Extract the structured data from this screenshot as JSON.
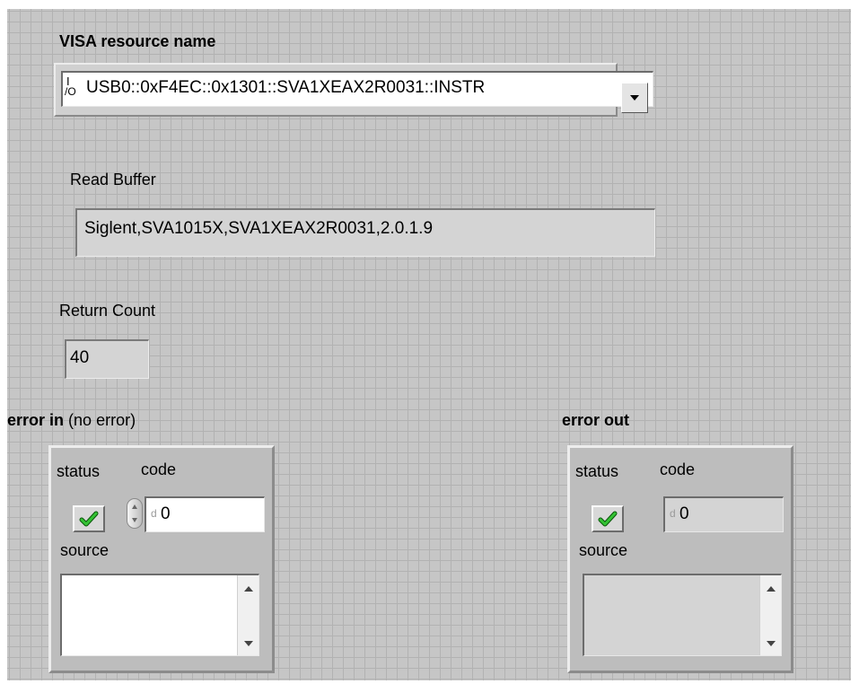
{
  "visa": {
    "label": "VISA resource name",
    "io_glyph_top": "I",
    "io_glyph_bottom": "/O",
    "value": "USB0::0xF4EC::0x1301::SVA1XEAX2R0031::INSTR",
    "dropdown_icon": "triangle-down-icon"
  },
  "read_buffer": {
    "label": "Read Buffer",
    "value": "Siglent,SVA1015X,SVA1XEAX2R0031,2.0.1.9"
  },
  "return_count": {
    "label": "Return Count",
    "value": "40"
  },
  "error_in": {
    "label_bold": "error in",
    "label_suffix": "(no error)",
    "status_label": "status",
    "code_label": "code",
    "radix": "d",
    "code_value": "0",
    "source_label": "source",
    "source_value": "",
    "status_icon": "green-checkmark-icon"
  },
  "error_out": {
    "label_bold": "error out",
    "status_label": "status",
    "code_label": "code",
    "radix": "d",
    "code_value": "0",
    "source_label": "source",
    "source_value": "",
    "status_icon": "green-checkmark-icon"
  },
  "colors": {
    "panel_bg": "#c6c6c6",
    "grid_line": "#b2b2b2",
    "check_green": "#2db52d"
  }
}
